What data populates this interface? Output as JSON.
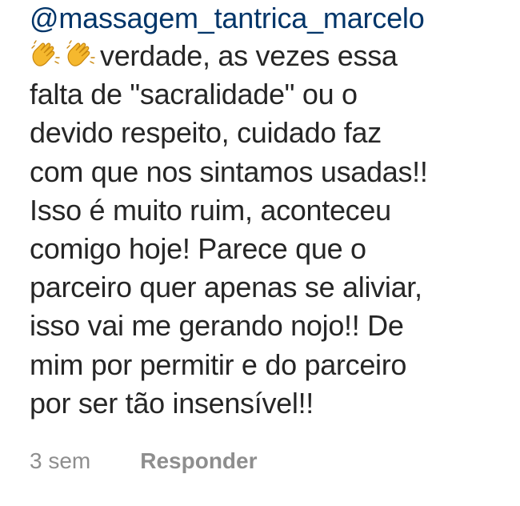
{
  "comment": {
    "mention": "@massagem_tantrica_marcelo",
    "icons": [
      "clapping-hands-icon",
      "clapping-hands-icon"
    ],
    "lines": [
      "verdade, as vezes essa",
      "falta de \"sacralidade\" ou o",
      "devido respeito, cuidado faz",
      "com que nos sintamos usadas!!",
      "Isso é muito ruim, aconteceu",
      "comigo hoje! Parece que o",
      "parceiro quer apenas se aliviar,",
      "isso vai me gerando nojo!! De",
      "mim por permitir e do parceiro",
      "por ser tão insensível!!"
    ]
  },
  "meta": {
    "timestamp": "3 sem",
    "reply_label": "Responder"
  },
  "colors": {
    "mention": "#003569",
    "text": "#262626",
    "meta": "#8e8e8e",
    "emoji": "#f5b82e"
  }
}
